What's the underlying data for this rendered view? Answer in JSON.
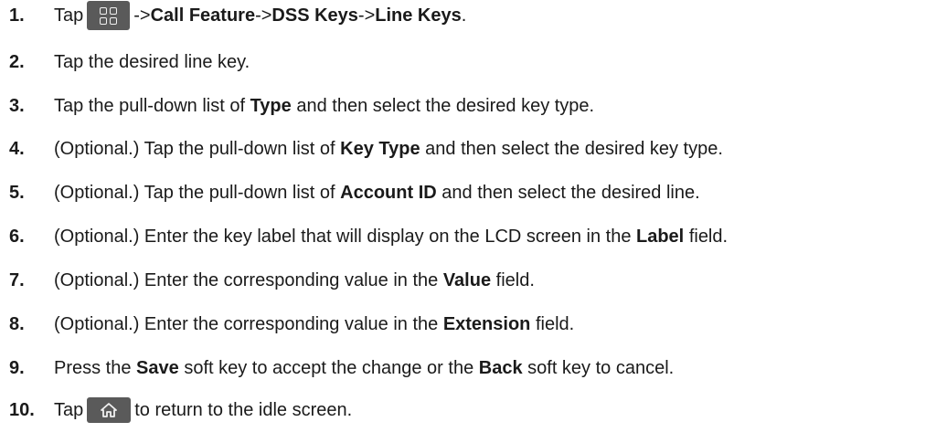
{
  "steps": [
    {
      "num": "1.",
      "pre": "Tap",
      "icon": "menu-grid-icon",
      "post": " ->",
      "b1": "Call Feature",
      "sep1": "->",
      "b2": "DSS Keys",
      "sep2": "->",
      "b3": "Line Keys",
      "end": "."
    },
    {
      "num": "2.",
      "text": "Tap the desired line key."
    },
    {
      "num": "3.",
      "pre": "Tap the pull-down list of ",
      "bold": "Type",
      "post": " and then select the desired key type."
    },
    {
      "num": "4.",
      "pre": "(Optional.) Tap the pull-down list of ",
      "bold": "Key Type",
      "post": " and then select the desired key type."
    },
    {
      "num": "5.",
      "pre": "(Optional.) Tap the pull-down list of ",
      "bold": "Account ID",
      "post": " and then select the desired line."
    },
    {
      "num": "6.",
      "pre": "(Optional.) Enter the key label that will display on the LCD screen in the ",
      "bold": "Label",
      "post": " field."
    },
    {
      "num": "7.",
      "pre": "(Optional.) Enter the corresponding value in the ",
      "bold": "Value",
      "post": " field."
    },
    {
      "num": "8.",
      "pre": "(Optional.) Enter the corresponding value in the ",
      "bold": "Extension",
      "post": " field."
    },
    {
      "num": "9.",
      "pre": "Press the ",
      "bold": "Save",
      "mid": " soft key to accept the change or the ",
      "bold2": "Back",
      "post": " soft key to cancel."
    },
    {
      "num": "10.",
      "pre": "Tap",
      "icon": "home-icon",
      "post": " to return to the idle screen."
    }
  ],
  "colors": {
    "text": "#1a1a1a",
    "icon_bg": "#5a5a5a",
    "icon_fg": "#f0f0f0"
  }
}
